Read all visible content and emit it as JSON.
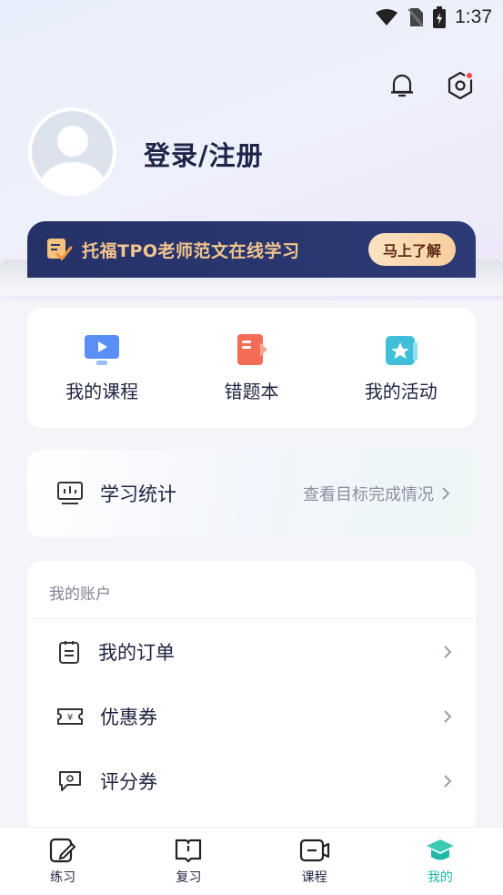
{
  "status_bar": {
    "time": "1:37"
  },
  "profile": {
    "login_label": "登录/注册"
  },
  "banner": {
    "text": "托福TPO老师范文在线学习",
    "button": "马上了解"
  },
  "quick_actions": [
    {
      "label": "我的课程",
      "icon": "course-play-icon"
    },
    {
      "label": "错题本",
      "icon": "error-book-icon"
    },
    {
      "label": "我的活动",
      "icon": "star-activity-icon"
    }
  ],
  "stats": {
    "title": "学习统计",
    "link": "查看目标完成情况"
  },
  "account": {
    "heading": "我的账户",
    "rows": [
      {
        "label": "我的订单",
        "icon": "order-icon"
      },
      {
        "label": "优惠券",
        "icon": "coupon-icon"
      },
      {
        "label": "评分券",
        "icon": "score-voucher-icon"
      }
    ]
  },
  "tabs": [
    {
      "label": "练习",
      "icon": "practice-icon"
    },
    {
      "label": "复习",
      "icon": "review-icon"
    },
    {
      "label": "课程",
      "icon": "course-icon"
    },
    {
      "label": "我的",
      "icon": "mine-icon",
      "active": true
    }
  ],
  "colors": {
    "accent": "#1fb9a6",
    "banner_bg": "#253268",
    "banner_text": "#f4c68e"
  }
}
